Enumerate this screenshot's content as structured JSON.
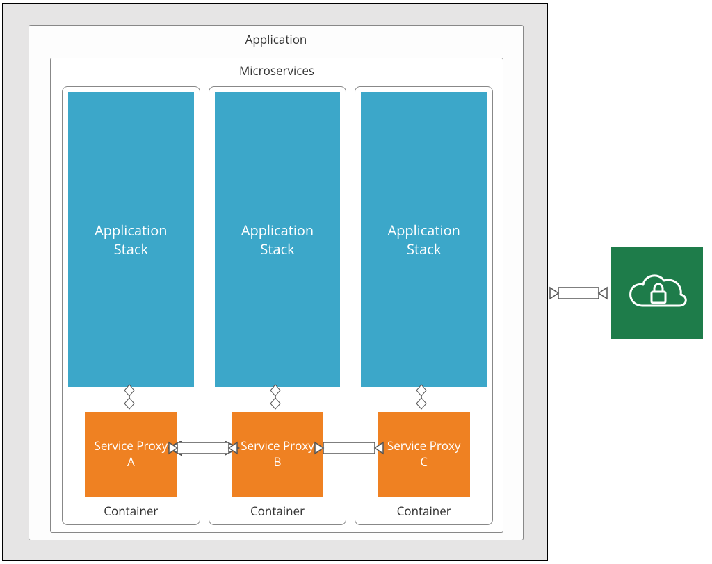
{
  "application": {
    "title": "Application"
  },
  "microservices": {
    "title": "Microservices",
    "containers": [
      {
        "stack_label": "Application\nStack",
        "proxy_label": "Service Proxy\nA",
        "container_label": "Container"
      },
      {
        "stack_label": "Application\nStack",
        "proxy_label": "Service Proxy\nB",
        "container_label": "Container"
      },
      {
        "stack_label": "Application\nStack",
        "proxy_label": "Service Proxy\nC",
        "container_label": "Container"
      }
    ]
  },
  "cloud": {
    "icon_name": "secure-cloud-icon"
  }
}
